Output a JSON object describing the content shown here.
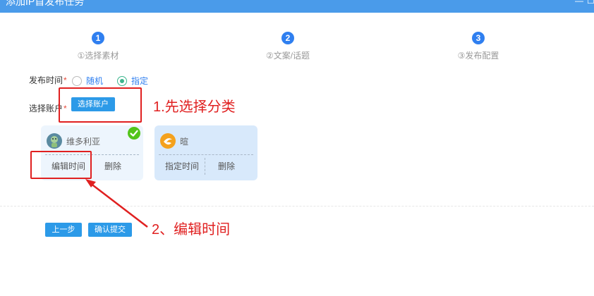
{
  "window": {
    "title": "添加IP首发布任务",
    "minimize_label": "—",
    "maximize_label": "☐"
  },
  "steps": [
    {
      "number": "1",
      "label": "①选择素材"
    },
    {
      "number": "2",
      "label": "②文案/话题"
    },
    {
      "number": "3",
      "label": "③发布配置"
    }
  ],
  "form": {
    "publish_time_label": "发布时间",
    "required_mark": "*",
    "radio_random": "随机",
    "radio_specified": "指定",
    "radio_selected": "指定",
    "select_account_label": "选择账户",
    "select_account_button": "选择账户"
  },
  "accounts": [
    {
      "name": "维多利亚",
      "action_1": "编辑时间",
      "action_2": "删除",
      "selected": true
    },
    {
      "name": "暄",
      "action_1": "指定时间",
      "action_2": "删除",
      "selected": false
    }
  ],
  "footer": {
    "prev_button": "上一步",
    "submit_button": "确认提交"
  },
  "annotations": {
    "note_1": "1.先选择分类",
    "note_2": "2、编辑时间",
    "color": "#e02020"
  },
  "colors": {
    "titlebar": "#4a9bea",
    "step_accent": "#2f7ff0",
    "button": "#2c9ae8",
    "radio_checked": "#3bb58d",
    "check_badge": "#52c41a"
  }
}
